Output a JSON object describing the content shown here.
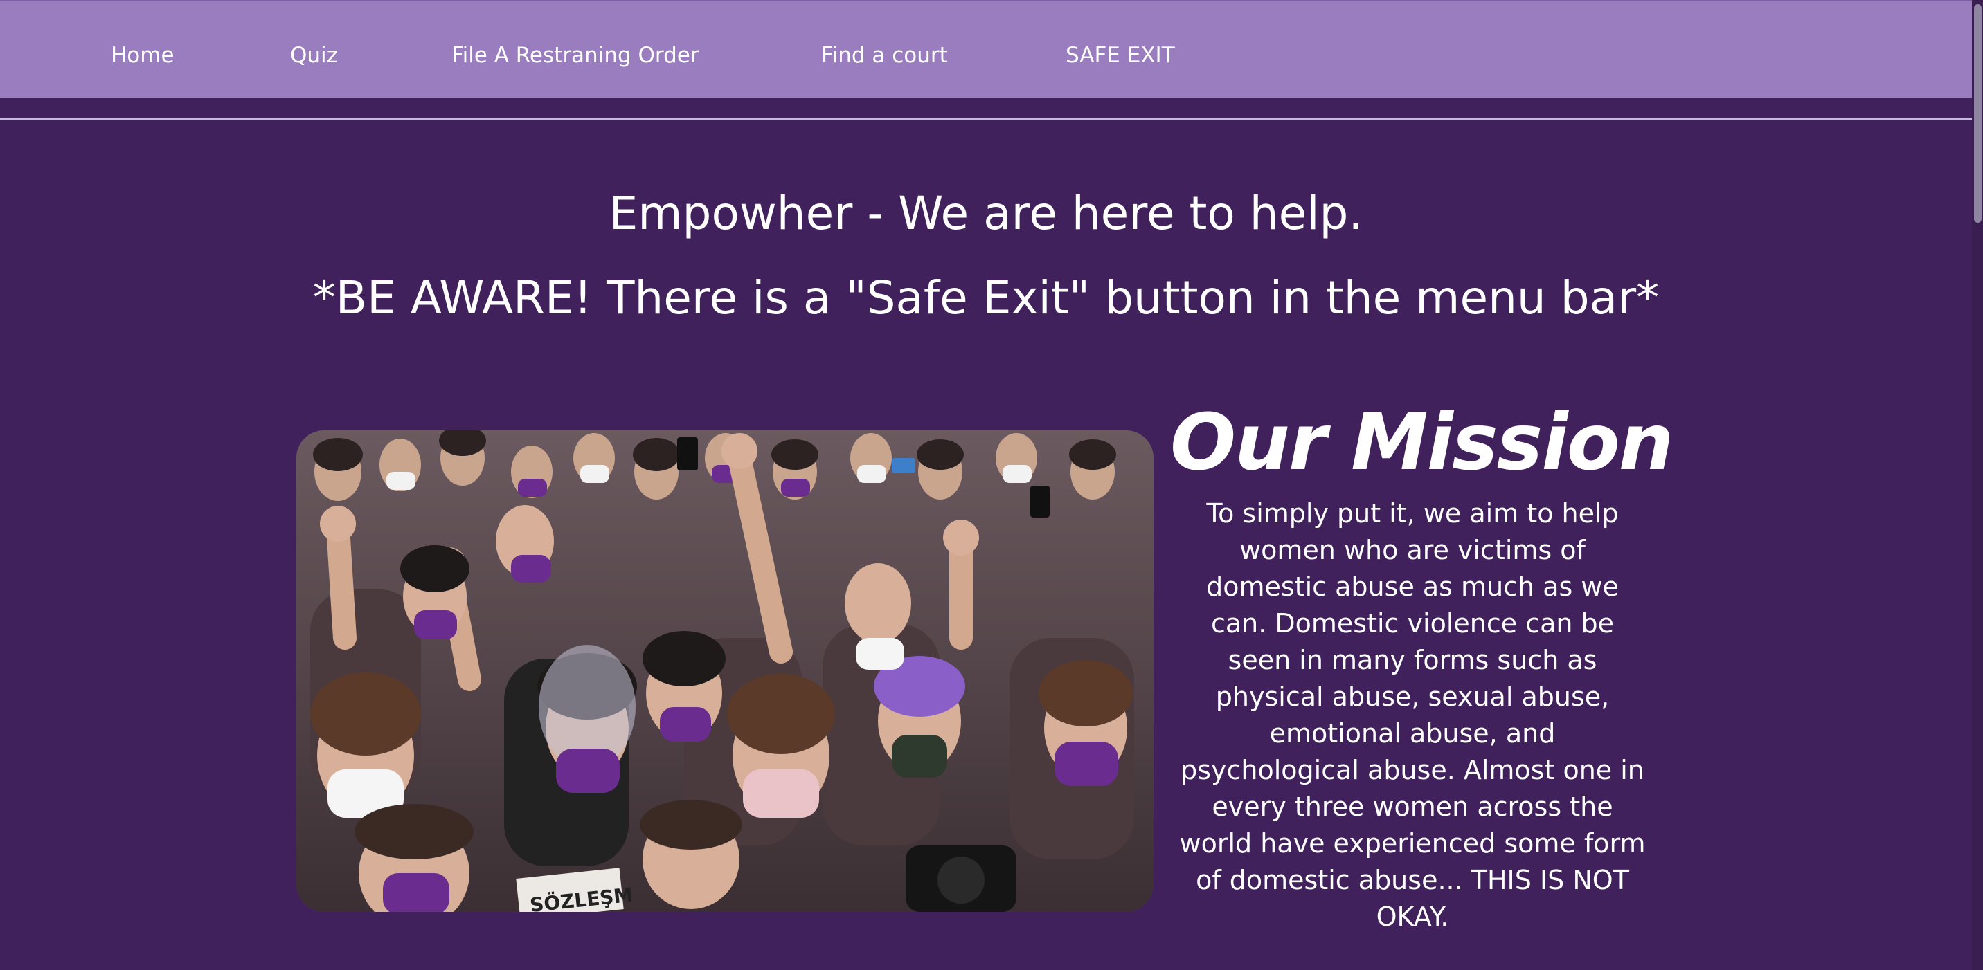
{
  "nav": {
    "items": [
      {
        "label": "Home"
      },
      {
        "label": "Quiz"
      },
      {
        "label": "File A Restraning Order"
      },
      {
        "label": "Find a court"
      },
      {
        "label": "SAFE EXIT"
      }
    ]
  },
  "header": {
    "title": "Empowher - We are here to help.",
    "warning": "*BE AWARE! There is a \"Safe Exit\" button in the menu bar*"
  },
  "mission": {
    "title": "Our Mission",
    "body": "To simply put it, we aim to help women who are victims of domestic abuse as much as we can. Domestic violence can be seen in many forms such as physical abuse, sexual abuse, emotional abuse, and psychological abuse. Almost one in every three women across the world have experienced some form of domestic abuse... THIS IS NOT OKAY."
  },
  "hero": {
    "sign_text": "SÖZLEŞM"
  },
  "colors": {
    "background": "#41215c",
    "navbar": "#997dbf",
    "divider": "#c9b8e3",
    "text": "#ffffff",
    "mask_purple": "#6a2c8e"
  }
}
